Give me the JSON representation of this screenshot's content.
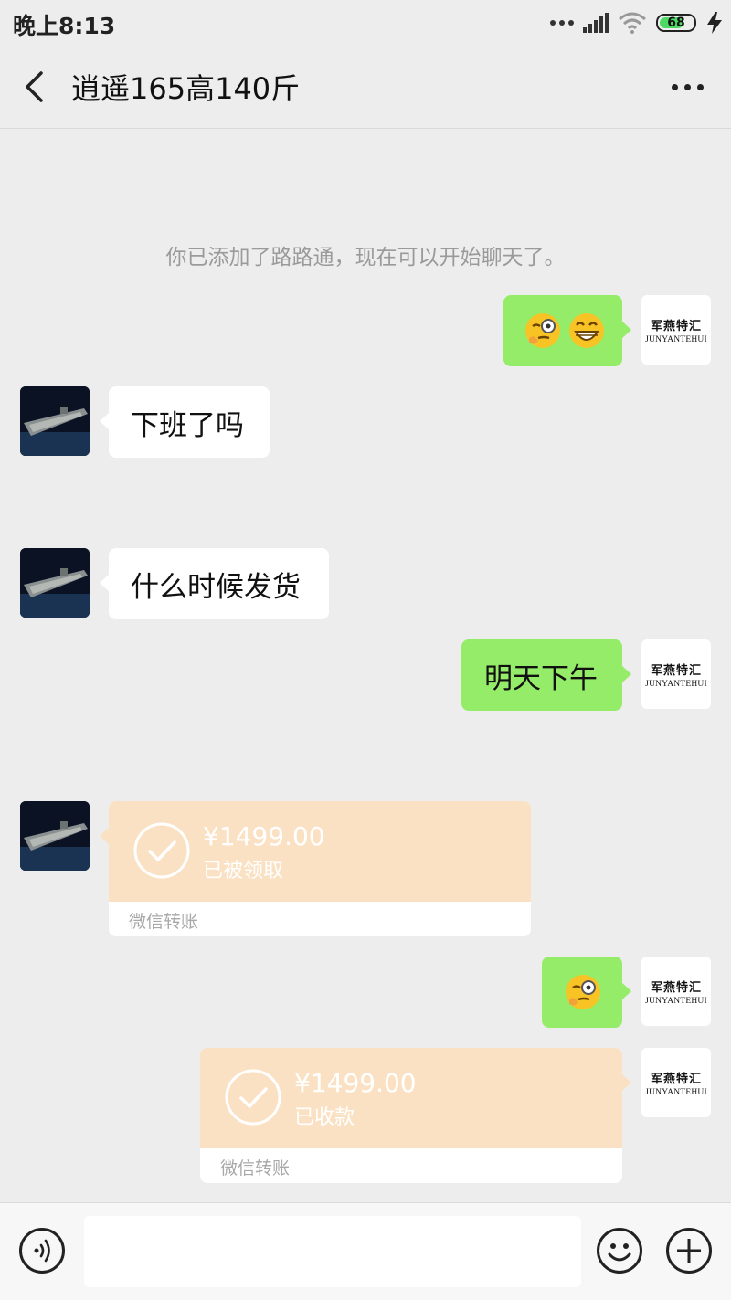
{
  "status_bar": {
    "time": "晚上8:13",
    "battery": "68"
  },
  "header": {
    "title": "逍遥165高140斤"
  },
  "system_message": "你已添加了路路通，现在可以开始聊天了。",
  "my_avatar": {
    "line1": "军燕特汇",
    "line2": "JUNYANTEHUI"
  },
  "messages": [
    {
      "side": "right",
      "type": "emoji",
      "emojis": [
        "thinking-face",
        "grinning-face"
      ]
    },
    {
      "side": "left",
      "type": "text",
      "text": "下班了吗"
    },
    {
      "side": "left",
      "type": "text",
      "text": "什么时候发货"
    },
    {
      "side": "right",
      "type": "text",
      "text": "明天下午"
    },
    {
      "side": "left",
      "type": "transfer",
      "amount": "¥1499.00",
      "status": "已被领取",
      "label": "微信转账"
    },
    {
      "side": "right",
      "type": "emoji",
      "emojis": [
        "thinking-face"
      ]
    },
    {
      "side": "right",
      "type": "transfer",
      "amount": "¥1499.00",
      "status": "已收款",
      "label": "微信转账"
    }
  ],
  "colors": {
    "bubble_green": "#95ec69",
    "transfer_bg": "#fbe1c3",
    "background": "#ededed"
  }
}
